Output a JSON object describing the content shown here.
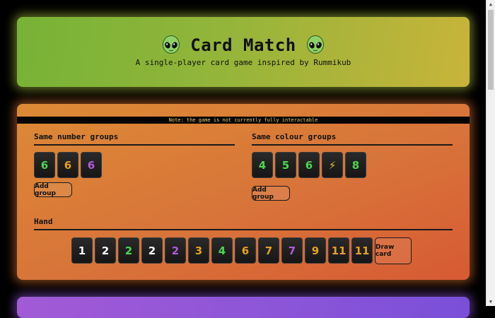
{
  "header": {
    "title": "Card Match",
    "subtitle": "A single-player card game inspired by Rummikub",
    "icon": "alien-icon"
  },
  "note": "Note: the game is not currently fully interactable",
  "same_number_groups": {
    "title": "Same number groups",
    "cards": [
      {
        "label": "6",
        "color": "#4cd64c"
      },
      {
        "label": "6",
        "color": "#e8a020"
      },
      {
        "label": "6",
        "color": "#b45ad8"
      }
    ],
    "button_label": "Add group"
  },
  "same_colour_groups": {
    "title": "Same colour groups",
    "cards": [
      {
        "label": "4",
        "color": "#4cd64c"
      },
      {
        "label": "5",
        "color": "#4cd64c"
      },
      {
        "label": "6",
        "color": "#4cd64c"
      },
      {
        "label": "⚡",
        "color": "#e8c030"
      },
      {
        "label": "8",
        "color": "#4cd64c"
      }
    ],
    "button_label": "Add group"
  },
  "hand": {
    "title": "Hand",
    "cards": [
      {
        "label": "1",
        "color": "#ffffff"
      },
      {
        "label": "2",
        "color": "#ffffff"
      },
      {
        "label": "2",
        "color": "#4cd64c"
      },
      {
        "label": "2",
        "color": "#ffffff"
      },
      {
        "label": "2",
        "color": "#b45ad8"
      },
      {
        "label": "3",
        "color": "#e8a020"
      },
      {
        "label": "4",
        "color": "#4cd64c"
      },
      {
        "label": "6",
        "color": "#e8a020"
      },
      {
        "label": "7",
        "color": "#e8a020"
      },
      {
        "label": "7",
        "color": "#b45ad8"
      },
      {
        "label": "9",
        "color": "#e8a020"
      },
      {
        "label": "11",
        "color": "#e8a020"
      },
      {
        "label": "11",
        "color": "#e8a020"
      }
    ],
    "draw_label": "Draw card"
  }
}
